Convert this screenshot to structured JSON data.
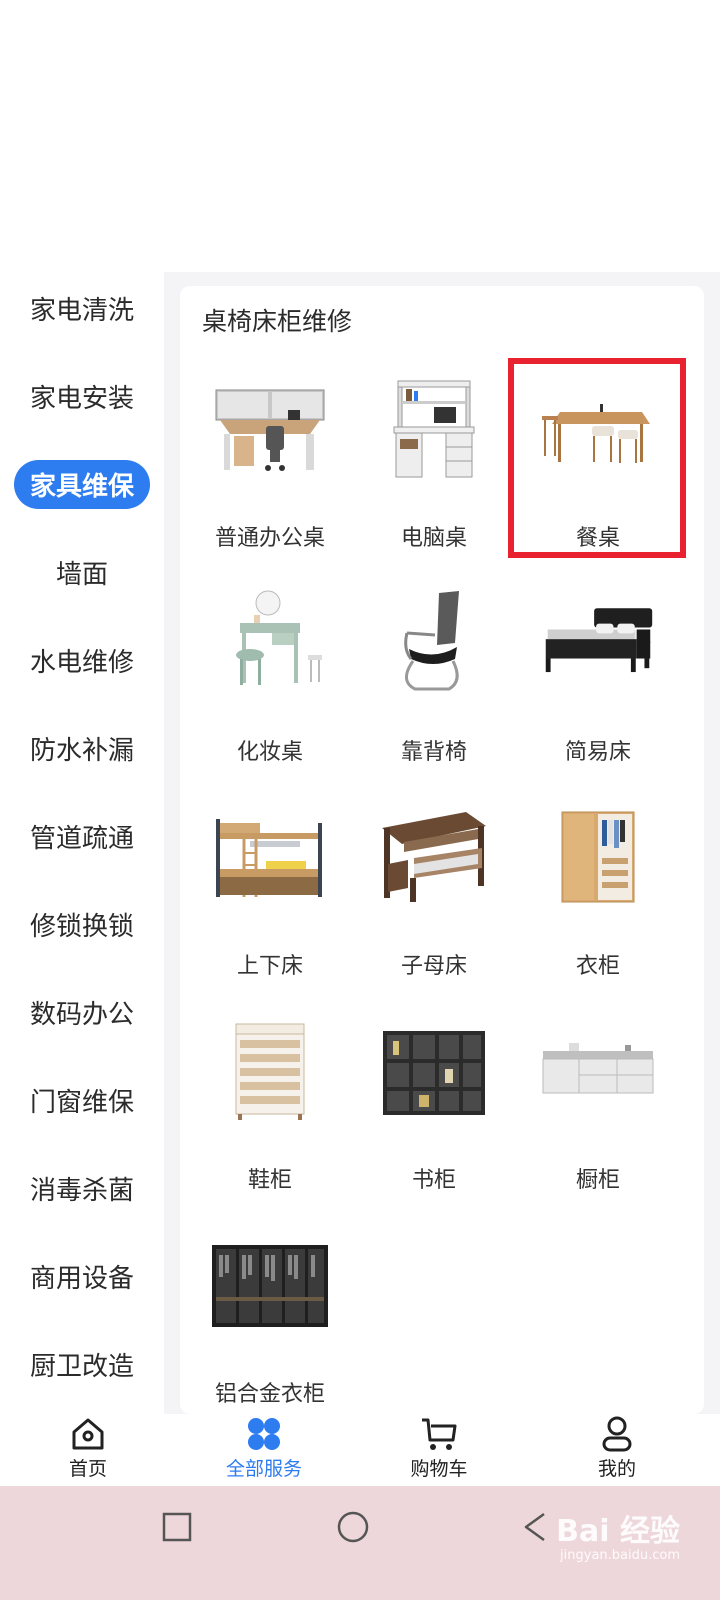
{
  "sidebar": {
    "items": [
      {
        "label": "家电清洗"
      },
      {
        "label": "家电安装"
      },
      {
        "label": "家具维保",
        "active": true
      },
      {
        "label": "墙面"
      },
      {
        "label": "水电维修"
      },
      {
        "label": "防水补漏"
      },
      {
        "label": "管道疏通"
      },
      {
        "label": "修锁换锁"
      },
      {
        "label": "数码办公"
      },
      {
        "label": "门窗维保"
      },
      {
        "label": "消毒杀菌"
      },
      {
        "label": "商用设备"
      },
      {
        "label": "厨卫改造"
      }
    ]
  },
  "panel": {
    "title": "桌椅床柜维修",
    "items": [
      {
        "label": "普通办公桌",
        "icon": "office-desk-image"
      },
      {
        "label": "电脑桌",
        "icon": "computer-desk-image"
      },
      {
        "label": "餐桌",
        "icon": "dining-table-image",
        "highlighted": true
      },
      {
        "label": "化妆桌",
        "icon": "dressing-table-image"
      },
      {
        "label": "靠背椅",
        "icon": "office-chair-image"
      },
      {
        "label": "简易床",
        "icon": "bed-image"
      },
      {
        "label": "上下床",
        "icon": "bunk-bed-image"
      },
      {
        "label": "子母床",
        "icon": "trundle-bed-image"
      },
      {
        "label": "衣柜",
        "icon": "wardrobe-image"
      },
      {
        "label": "鞋柜",
        "icon": "shoe-cabinet-image"
      },
      {
        "label": "书柜",
        "icon": "bookcase-image"
      },
      {
        "label": "橱柜",
        "icon": "kitchen-cabinet-image"
      },
      {
        "label": "铝合金衣柜",
        "icon": "aluminum-wardrobe-image"
      }
    ]
  },
  "bottom_nav": {
    "items": [
      {
        "label": "首页",
        "icon": "home-icon"
      },
      {
        "label": "全部服务",
        "icon": "services-icon",
        "active": true
      },
      {
        "label": "购物车",
        "icon": "cart-icon"
      },
      {
        "label": "我的",
        "icon": "profile-icon"
      }
    ]
  },
  "system_bar": {
    "buttons": [
      "recent-apps-icon",
      "home-circle-icon",
      "back-icon"
    ],
    "watermark": "Bai 经验",
    "watermark_sub": "jingyan.baidu.com"
  },
  "colors": {
    "accent": "#2d7cf0",
    "highlight": "#e8222e",
    "panel_bg": "#f4f4f6",
    "system_bar": "#eed7db"
  }
}
